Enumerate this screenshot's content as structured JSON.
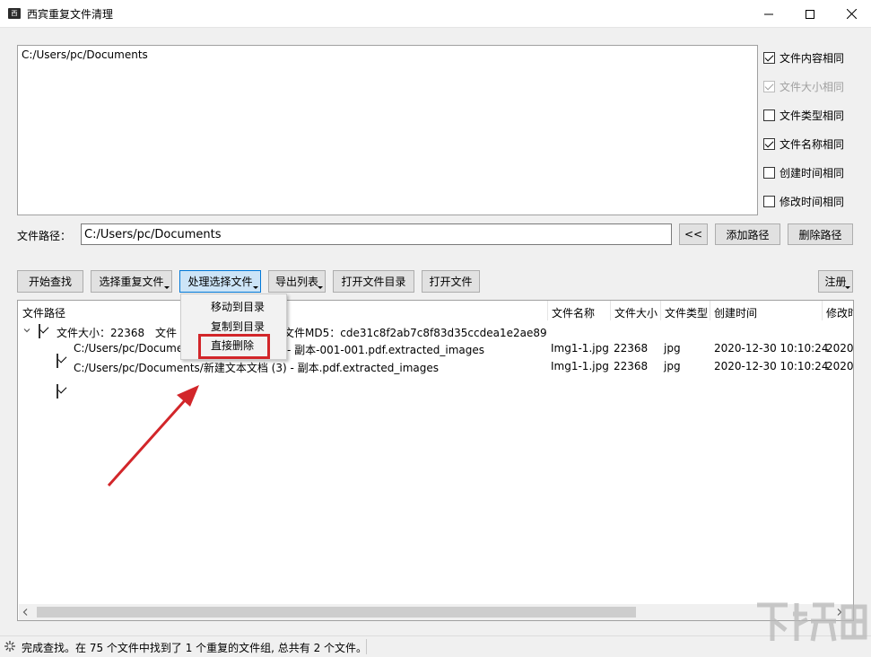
{
  "window": {
    "icon_text": "西",
    "title": "西宾重复文件清理"
  },
  "path_list": {
    "items": [
      "C:/Users/pc/Documents"
    ]
  },
  "options": [
    {
      "label": "文件内容相同",
      "checked": true,
      "enabled": true
    },
    {
      "label": "文件大小相同",
      "checked": true,
      "enabled": false
    },
    {
      "label": "文件类型相同",
      "checked": false,
      "enabled": true
    },
    {
      "label": "文件名称相同",
      "checked": true,
      "enabled": true
    },
    {
      "label": "创建时间相同",
      "checked": false,
      "enabled": true
    },
    {
      "label": "修改时间相同",
      "checked": false,
      "enabled": true
    }
  ],
  "path_row": {
    "label": "文件路径：",
    "value": "C:/Users/pc/Documents",
    "back_label": "<<",
    "add_label": "添加路径",
    "delete_label": "删除路径"
  },
  "toolbar": {
    "start": "开始查找",
    "select_dup": "选择重复文件",
    "process": "处理选择文件",
    "export": "导出列表",
    "open_dir": "打开文件目录",
    "open_file": "打开文件",
    "register": "注册"
  },
  "table": {
    "columns": [
      "文件路径",
      "文件名称",
      "文件大小",
      "文件类型",
      "创建时间",
      "修改时"
    ],
    "group": {
      "size_text": "文件大小：22368",
      "name_fragment": "文件",
      "md5_text": "文件MD5：cde31c8f2ab7c8f83d35ccdea1e2ae89",
      "checked": true
    },
    "rows": [
      {
        "path_start": "C:/Users/pc/Docume",
        "path_end": "- 副本-001-001.pdf.extracted_images",
        "name": "Img1-1.jpg",
        "size": "22368",
        "type": "jpg",
        "created": "2020-12-30 10:10:24",
        "modified": "2020-",
        "checked": true
      },
      {
        "path_start": "C:/Users/pc/Documents/新建文本文档 (3) - 副本.pdf.extracted_images",
        "path_end": "",
        "name": "Img1-1.jpg",
        "size": "22368",
        "type": "jpg",
        "created": "2020-12-30 10:10:24",
        "modified": "2020-",
        "checked": true
      }
    ]
  },
  "context_menu": {
    "items": [
      "移动到目录",
      "复制到目录",
      "直接删除"
    ],
    "highlighted_index": 2,
    "highlight_color": "#d2262a"
  },
  "status": {
    "text": "完成查找。在 75 个文件中找到了 1 个重复的文件组, 总共有 2 个文件。"
  },
  "watermark": {
    "text": "下载吧"
  },
  "colors": {
    "accent": "#0078d7",
    "annotation_red": "#d2262a"
  }
}
